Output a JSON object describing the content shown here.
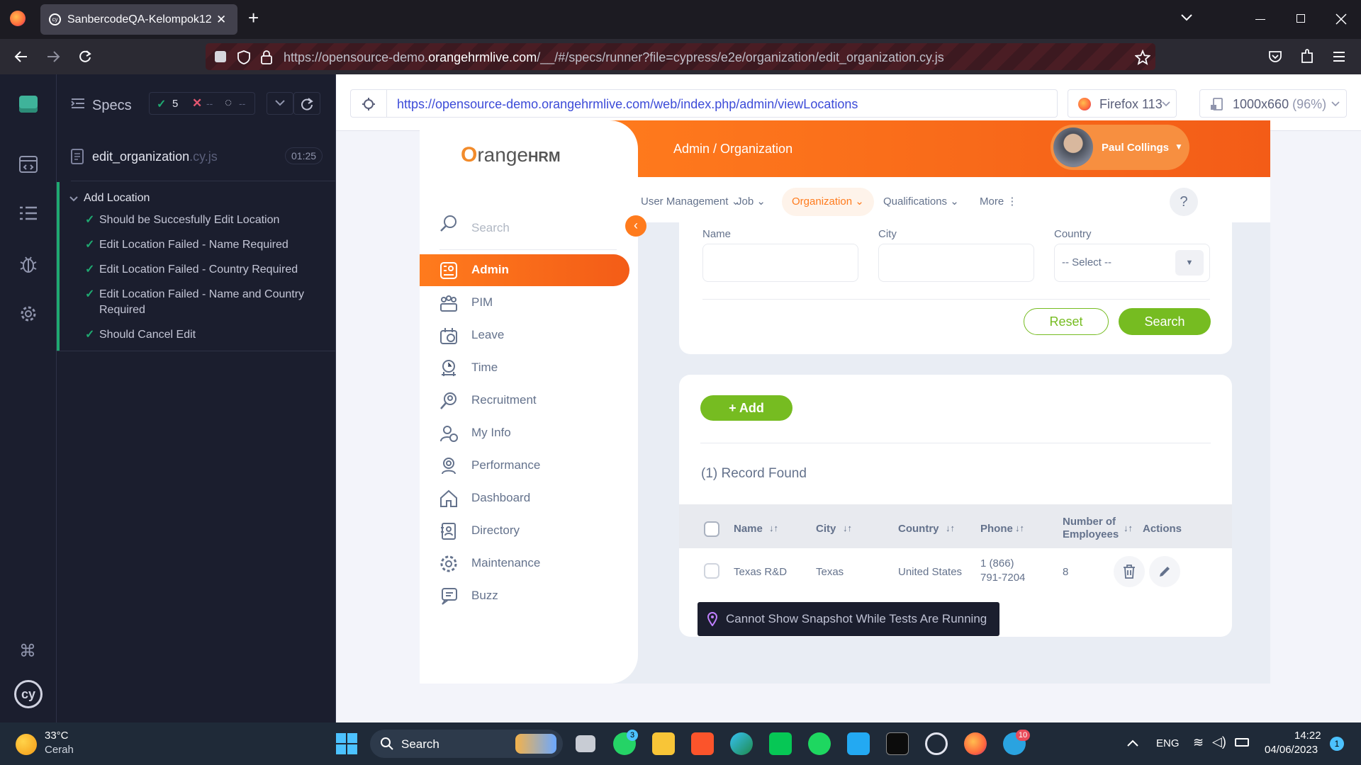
{
  "browser": {
    "tab_title": "SanbercodeQA-Kelompok12",
    "close_tab": "✕",
    "new_tab": "+",
    "url_prefix": "https://opensource-demo.",
    "url_domain": "orangehrmlive.com",
    "url_suffix": "/__/#/specs/runner?file=cypress/e2e/organization/edit_organization.cy.js"
  },
  "cypress": {
    "specs_label": "Specs",
    "passed_count": "5",
    "failed_count": "--",
    "pending_count": "--",
    "spec_name": "edit_organization",
    "spec_ext": ".cy.js",
    "duration": "01:25",
    "suite_title": "Add Location",
    "tests": [
      {
        "label": "Should be Succesfully Edit Location"
      },
      {
        "label": "Edit Location Failed - Name Required"
      },
      {
        "label": "Edit Location Failed - Country Required"
      },
      {
        "label": "Edit Location Failed - Name and Country Required"
      },
      {
        "label": "Should Cancel Edit"
      }
    ],
    "aut_url": "https://opensource-demo.orangehrmlive.com/web/index.php/admin/viewLocations",
    "browser_selector": "Firefox 113",
    "viewport_size": "1000x660",
    "viewport_scale": "(96%)",
    "snapshot_message": "Cannot Show Snapshot While Tests Are Running"
  },
  "orangehrm": {
    "logo_main": "range",
    "logo_hrm": "HRM",
    "breadcrumb": "Admin / Organization",
    "user_name": "Paul Collings",
    "search_placeholder": "Search",
    "menu": [
      {
        "label": "Admin",
        "icon": "admin-icon",
        "active": true
      },
      {
        "label": "PIM",
        "icon": "pim-icon"
      },
      {
        "label": "Leave",
        "icon": "leave-icon"
      },
      {
        "label": "Time",
        "icon": "time-icon"
      },
      {
        "label": "Recruitment",
        "icon": "recruitment-icon"
      },
      {
        "label": "My Info",
        "icon": "myinfo-icon"
      },
      {
        "label": "Performance",
        "icon": "performance-icon"
      },
      {
        "label": "Dashboard",
        "icon": "dashboard-icon"
      },
      {
        "label": "Directory",
        "icon": "directory-icon"
      },
      {
        "label": "Maintenance",
        "icon": "maintenance-icon"
      },
      {
        "label": "Buzz",
        "icon": "buzz-icon"
      }
    ],
    "topnav": [
      "User Management",
      "Job",
      "Organization",
      "Qualifications",
      "More"
    ],
    "help": "?",
    "filters": {
      "name_label": "Name",
      "city_label": "City",
      "country_label": "Country",
      "country_value": "-- Select --",
      "reset": "Reset",
      "search": "Search"
    },
    "add_button": "Add",
    "records_found": "(1) Record Found",
    "table": {
      "headers": [
        "Name",
        "City",
        "Country",
        "Phone",
        "Number of Employees",
        "Actions"
      ],
      "rows": [
        {
          "name": "Texas R&D",
          "city": "Texas",
          "country": "United States",
          "phone_line1": "1 (866)",
          "phone_line2": "791-7204",
          "employees": "8"
        }
      ]
    }
  },
  "taskbar": {
    "temperature": "33°C",
    "weather": "Cerah",
    "search": "Search",
    "whatsapp_badge": "3",
    "telegram_badge": "10",
    "language": "ENG",
    "time": "14:22",
    "date": "04/06/2023",
    "notification_count": "1"
  },
  "colors": {
    "orange": "#ff7b1d",
    "green": "#76bc21",
    "cypress_pass": "#1fa971"
  }
}
